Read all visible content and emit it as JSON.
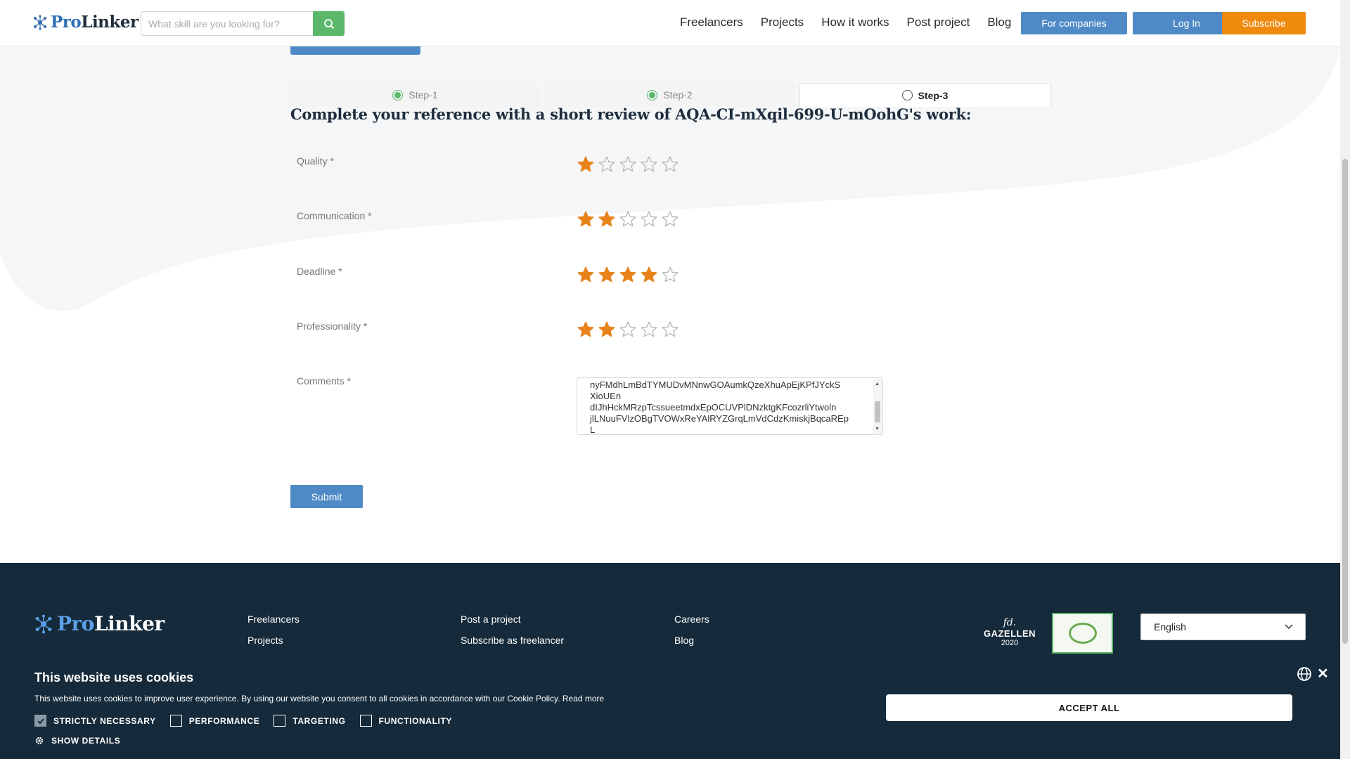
{
  "header": {
    "logo_text_pro": "Pro",
    "logo_text_linker": "Linker",
    "search_placeholder": "What skill are you looking for?",
    "nav": [
      "Freelancers",
      "Projects",
      "How it works",
      "Post project",
      "Blog"
    ],
    "for_companies": "For companies",
    "login": "Log In",
    "subscribe": "Subscribe"
  },
  "steps": [
    {
      "label": "Step-1",
      "state": "done"
    },
    {
      "label": "Step-2",
      "state": "done"
    },
    {
      "label": "Step-3",
      "state": "active"
    }
  ],
  "form": {
    "title": "Complete your reference with a short review of AQA-CI-mXqil-699-U-mOohG's work:",
    "ratings": [
      {
        "label": "Quality *",
        "value": 1,
        "max": 5
      },
      {
        "label": "Communication *",
        "value": 2,
        "max": 5
      },
      {
        "label": "Deadline *",
        "value": 4,
        "max": 5
      },
      {
        "label": "Professionality *",
        "value": 2,
        "max": 5
      }
    ],
    "comments_label": "Comments *",
    "comments_value": "nyFMdhLmBdTYMUDvMNnwGOAumkQzeXhuApEjKPfJYckS\nXioUEn\ndIJhHckMRzpTcssueetmdxEpOCUVPlDNzktgKFcozrliYtwoln\njlLNuuFVlzOBgTVOWxReYAlRYZGrqLmVdCdzKmiskjBqcaREp\nL",
    "submit": "Submit"
  },
  "footer": {
    "logo_text_pro": "Pro",
    "logo_text_linker": "Linker",
    "col1": [
      "Freelancers",
      "Projects"
    ],
    "col2": [
      "Post a project",
      "Subscribe as freelancer"
    ],
    "col3": [
      "Careers",
      "Blog"
    ],
    "badge_fd": {
      "fd": "fd.",
      "name": "GAZELLEN",
      "year": "2020"
    },
    "language": "English"
  },
  "cookie": {
    "title": "This website uses cookies",
    "text": "This website uses cookies to improve user experience. By using our website you consent to all cookies in accordance with our Cookie Policy. Read more",
    "options": [
      {
        "label": "STRICTLY NECESSARY",
        "checked": true
      },
      {
        "label": "PERFORMANCE",
        "checked": false
      },
      {
        "label": "TARGETING",
        "checked": false
      },
      {
        "label": "FUNCTIONALITY",
        "checked": false
      }
    ],
    "show_details": "SHOW DETAILS",
    "accept_all": "ACCEPT ALL"
  },
  "colors": {
    "accent_blue": "#4f8ac6",
    "accent_orange": "#ef8a0f",
    "accent_green": "#5bb86a",
    "footer_bg": "#152a3a",
    "star_filled": "#e8821a"
  },
  "icons": [
    "logo-molecule-icon",
    "search-icon",
    "star-icon",
    "chevron-down-icon",
    "globe-icon",
    "close-icon",
    "gear-icon"
  ]
}
